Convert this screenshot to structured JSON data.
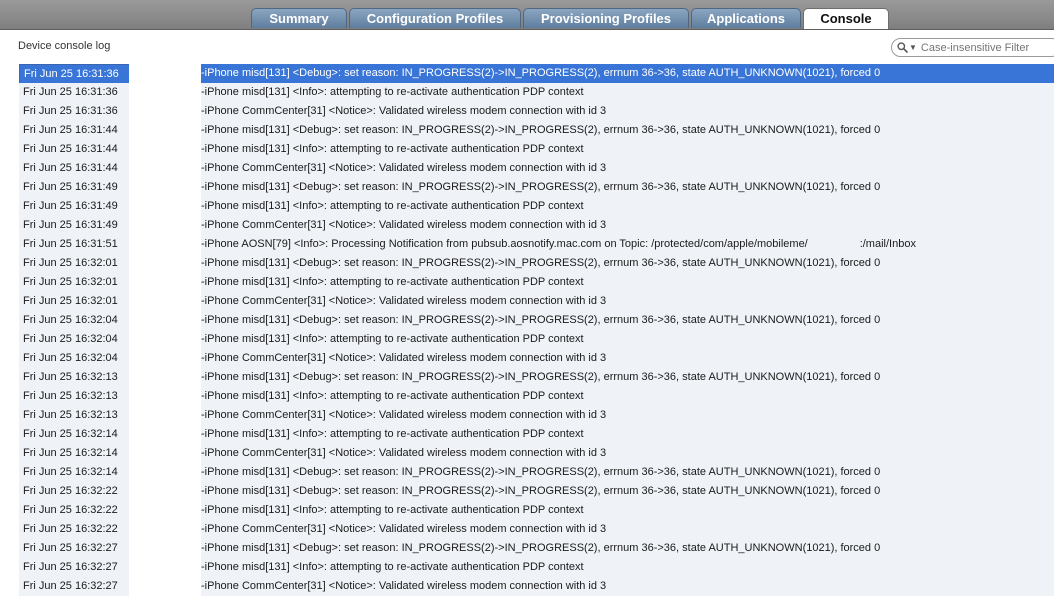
{
  "tabs": [
    {
      "label": "Summary",
      "active": false
    },
    {
      "label": "Configuration Profiles",
      "active": false
    },
    {
      "label": "Provisioning Profiles",
      "active": false
    },
    {
      "label": "Applications",
      "active": false
    },
    {
      "label": "Console",
      "active": true
    }
  ],
  "console": {
    "title": "Device console log",
    "filter_placeholder": "Case-insensitive Filter",
    "selected_row": 0,
    "rows": [
      {
        "time": "Fri Jun 25 16:31:36",
        "message": "-iPhone misd[131] <Debug>: set reason: IN_PROGRESS(2)->IN_PROGRESS(2), errnum 36->36, state AUTH_UNKNOWN(1021), forced 0"
      },
      {
        "time": "Fri Jun 25 16:31:36",
        "message": "-iPhone misd[131] <Info>: attempting to re-activate authentication PDP context"
      },
      {
        "time": "Fri Jun 25 16:31:36",
        "message": "-iPhone CommCenter[31] <Notice>: Validated wireless modem connection with id 3"
      },
      {
        "time": "Fri Jun 25 16:31:44",
        "message": "-iPhone misd[131] <Debug>: set reason: IN_PROGRESS(2)->IN_PROGRESS(2), errnum 36->36, state AUTH_UNKNOWN(1021), forced 0"
      },
      {
        "time": "Fri Jun 25 16:31:44",
        "message": "-iPhone misd[131] <Info>: attempting to re-activate authentication PDP context"
      },
      {
        "time": "Fri Jun 25 16:31:44",
        "message": "-iPhone CommCenter[31] <Notice>: Validated wireless modem connection with id 3"
      },
      {
        "time": "Fri Jun 25 16:31:49",
        "message": "-iPhone misd[131] <Debug>: set reason: IN_PROGRESS(2)->IN_PROGRESS(2), errnum 36->36, state AUTH_UNKNOWN(1021), forced 0"
      },
      {
        "time": "Fri Jun 25 16:31:49",
        "message": "-iPhone misd[131] <Info>: attempting to re-activate authentication PDP context"
      },
      {
        "time": "Fri Jun 25 16:31:49",
        "message": "-iPhone CommCenter[31] <Notice>: Validated wireless modem connection with id 3"
      },
      {
        "time": "Fri Jun 25 16:31:51",
        "message": "-iPhone AOSN[79] <Info>: Processing Notification from pubsub.aosnotify.mac.com on Topic: /protected/com/apple/mobileme/                 :/mail/Inbox"
      },
      {
        "time": "Fri Jun 25 16:32:01",
        "message": "-iPhone misd[131] <Debug>: set reason: IN_PROGRESS(2)->IN_PROGRESS(2), errnum 36->36, state AUTH_UNKNOWN(1021), forced 0"
      },
      {
        "time": "Fri Jun 25 16:32:01",
        "message": "-iPhone misd[131] <Info>: attempting to re-activate authentication PDP context"
      },
      {
        "time": "Fri Jun 25 16:32:01",
        "message": "-iPhone CommCenter[31] <Notice>: Validated wireless modem connection with id 3"
      },
      {
        "time": "Fri Jun 25 16:32:04",
        "message": "-iPhone misd[131] <Debug>: set reason: IN_PROGRESS(2)->IN_PROGRESS(2), errnum 36->36, state AUTH_UNKNOWN(1021), forced 0"
      },
      {
        "time": "Fri Jun 25 16:32:04",
        "message": "-iPhone misd[131] <Info>: attempting to re-activate authentication PDP context"
      },
      {
        "time": "Fri Jun 25 16:32:04",
        "message": "-iPhone CommCenter[31] <Notice>: Validated wireless modem connection with id 3"
      },
      {
        "time": "Fri Jun 25 16:32:13",
        "message": "-iPhone misd[131] <Debug>: set reason: IN_PROGRESS(2)->IN_PROGRESS(2), errnum 36->36, state AUTH_UNKNOWN(1021), forced 0"
      },
      {
        "time": "Fri Jun 25 16:32:13",
        "message": "-iPhone misd[131] <Info>: attempting to re-activate authentication PDP context"
      },
      {
        "time": "Fri Jun 25 16:32:13",
        "message": "-iPhone CommCenter[31] <Notice>: Validated wireless modem connection with id 3"
      },
      {
        "time": "Fri Jun 25 16:32:14",
        "message": "-iPhone misd[131] <Info>: attempting to re-activate authentication PDP context"
      },
      {
        "time": "Fri Jun 25 16:32:14",
        "message": "-iPhone CommCenter[31] <Notice>: Validated wireless modem connection with id 3"
      },
      {
        "time": "Fri Jun 25 16:32:14",
        "message": "-iPhone misd[131] <Debug>: set reason: IN_PROGRESS(2)->IN_PROGRESS(2), errnum 36->36, state AUTH_UNKNOWN(1021), forced 0"
      },
      {
        "time": "Fri Jun 25 16:32:22",
        "message": "-iPhone misd[131] <Debug>: set reason: IN_PROGRESS(2)->IN_PROGRESS(2), errnum 36->36, state AUTH_UNKNOWN(1021), forced 0"
      },
      {
        "time": "Fri Jun 25 16:32:22",
        "message": "-iPhone misd[131] <Info>: attempting to re-activate authentication PDP context"
      },
      {
        "time": "Fri Jun 25 16:32:22",
        "message": "-iPhone CommCenter[31] <Notice>: Validated wireless modem connection with id 3"
      },
      {
        "time": "Fri Jun 25 16:32:27",
        "message": "-iPhone misd[131] <Debug>: set reason: IN_PROGRESS(2)->IN_PROGRESS(2), errnum 36->36, state AUTH_UNKNOWN(1021), forced 0"
      },
      {
        "time": "Fri Jun 25 16:32:27",
        "message": "-iPhone misd[131] <Info>: attempting to re-activate authentication PDP context"
      },
      {
        "time": "Fri Jun 25 16:32:27",
        "message": "-iPhone CommCenter[31] <Notice>: Validated wireless modem connection with id 3"
      }
    ]
  }
}
